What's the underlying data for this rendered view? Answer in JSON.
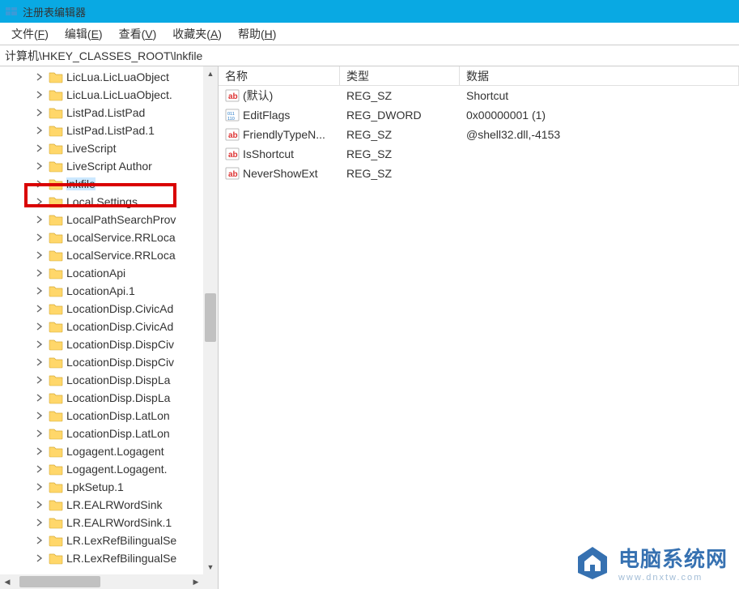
{
  "titlebar": {
    "title": "注册表编辑器"
  },
  "menubar": {
    "items": [
      {
        "label": "文件",
        "accel": "F"
      },
      {
        "label": "编辑",
        "accel": "E"
      },
      {
        "label": "查看",
        "accel": "V"
      },
      {
        "label": "收藏夹",
        "accel": "A"
      },
      {
        "label": "帮助",
        "accel": "H"
      }
    ]
  },
  "addressbar": {
    "path": "计算机\\HKEY_CLASSES_ROOT\\lnkfile"
  },
  "tree": {
    "items": [
      {
        "label": "LicLua.LicLuaObject"
      },
      {
        "label": "LicLua.LicLuaObject."
      },
      {
        "label": "ListPad.ListPad"
      },
      {
        "label": "ListPad.ListPad.1"
      },
      {
        "label": "LiveScript"
      },
      {
        "label": "LiveScript Author"
      },
      {
        "label": "lnkfile",
        "selected": true
      },
      {
        "label": "Local Settings"
      },
      {
        "label": "LocalPathSearchProv"
      },
      {
        "label": "LocalService.RRLoca"
      },
      {
        "label": "LocalService.RRLoca"
      },
      {
        "label": "LocationApi"
      },
      {
        "label": "LocationApi.1"
      },
      {
        "label": "LocationDisp.CivicAd"
      },
      {
        "label": "LocationDisp.CivicAd"
      },
      {
        "label": "LocationDisp.DispCiv"
      },
      {
        "label": "LocationDisp.DispCiv"
      },
      {
        "label": "LocationDisp.DispLa"
      },
      {
        "label": "LocationDisp.DispLa"
      },
      {
        "label": "LocationDisp.LatLon"
      },
      {
        "label": "LocationDisp.LatLon"
      },
      {
        "label": "Logagent.Logagent"
      },
      {
        "label": "Logagent.Logagent."
      },
      {
        "label": "LpkSetup.1"
      },
      {
        "label": "LR.EALRWordSink"
      },
      {
        "label": "LR.EALRWordSink.1"
      },
      {
        "label": "LR.LexRefBilingualSe"
      },
      {
        "label": "LR.LexRefBilingualSe"
      }
    ]
  },
  "list": {
    "headers": {
      "name": "名称",
      "type": "类型",
      "data": "数据"
    },
    "rows": [
      {
        "icon": "string",
        "name": "(默认)",
        "type": "REG_SZ",
        "data": "Shortcut"
      },
      {
        "icon": "binary",
        "name": "EditFlags",
        "type": "REG_DWORD",
        "data": "0x00000001 (1)"
      },
      {
        "icon": "string",
        "name": "FriendlyTypeN...",
        "type": "REG_SZ",
        "data": "@shell32.dll,-4153"
      },
      {
        "icon": "string",
        "name": "IsShortcut",
        "type": "REG_SZ",
        "data": ""
      },
      {
        "icon": "string",
        "name": "NeverShowExt",
        "type": "REG_SZ",
        "data": ""
      }
    ]
  },
  "watermark": {
    "main": "电脑系统网",
    "sub": "www.dnxtw.com"
  }
}
